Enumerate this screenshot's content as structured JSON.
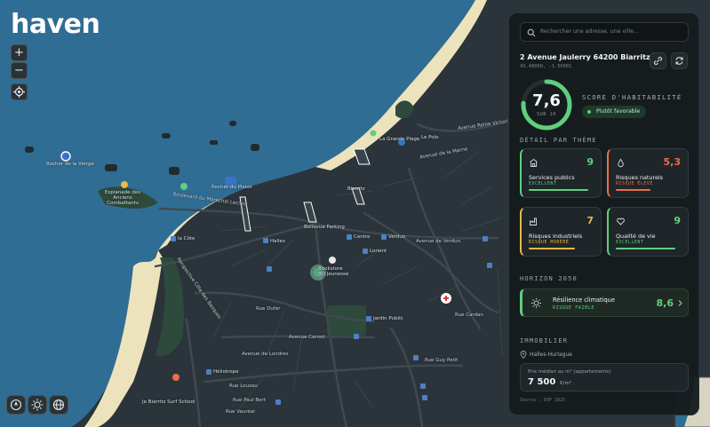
{
  "app": {
    "logo": "haven"
  },
  "map_controls": {
    "zoom_in": "+",
    "zoom_out": "−"
  },
  "map_labels": {
    "rocher_vierge": "Rocher de la Vierge",
    "esplanade": "Esplanade des Anciens Combattants",
    "rocher_plaisir": "Rocher du Plaisir",
    "grande_plage": "La Grande Plage",
    "boulevard_marechal": "Boulevard du Maréchal Leclerc",
    "avenue_reine_victoria": "Avenue Reine Victoria",
    "avenue_marne": "Avenue de la Marne",
    "le_polo": "Le Polo",
    "biarritz": "Biarritz",
    "bellevue_parking": "Bellevue Parking",
    "halles": "Halles",
    "centre": "Centre",
    "verdun": "Verdun",
    "avenue_verdun": "Avenue de Verdun",
    "lorient": "Lorient",
    "bookstore": "Bookstore BD Jeunesse",
    "la_cote": "la Côte",
    "perspective": "Perspective Côte des Basques",
    "rue_dufer": "Rue Dufer",
    "avenue_carnot": "Avenue Carnot",
    "jardin_public": "Jardin Public",
    "rue_cardan": "Rue Cardan",
    "avenue_londres": "Avenue de Londres",
    "rue_paul_bert": "Rue Paul Bert",
    "rue_louzau": "Rue Louzau",
    "rue_vaureal": "Rue Vauréal",
    "rue_guy_petit": "Rue Guy Petit",
    "surf_school": "Je Biarritz Surf School",
    "heliotrope": "Héliotrope"
  },
  "panel": {
    "search_placeholder": "Rechercher une adresse, une ville...",
    "address": "2 Avenue Jaulerry 64200 Biarritz",
    "coords": "43.48060, -1.56001",
    "score": {
      "value": "7,6",
      "max": "SUR 10",
      "value_fraction": 0.76,
      "title": "SCORE D'HABITABILITÉ",
      "verdict": "Plutôt favorable"
    },
    "themes_title": "DÉTAIL PAR THÈME",
    "themes": [
      {
        "title": "Services publics",
        "status": "EXCELLENT",
        "score": "9",
        "level": 0.9,
        "color": "#5fcf7e"
      },
      {
        "title": "Risques naturels",
        "status": "RISQUE ÉLEVÉ",
        "score": "5,3",
        "level": 0.53,
        "color": "#ea6e4b"
      },
      {
        "title": "Risques industriels",
        "status": "RISQUE MODÉRÉ",
        "score": "7",
        "level": 0.7,
        "color": "#e8b84a"
      },
      {
        "title": "Qualité de vie",
        "status": "EXCELLENT",
        "score": "9",
        "level": 0.9,
        "color": "#5fcf7e"
      }
    ],
    "horizon_title": "HORIZON 2050",
    "resilience": {
      "title": "Résilience climatique",
      "status": "RISQUE FAIBLE",
      "score": "8,6"
    },
    "immobilier_title": "IMMOBILIER",
    "location": "Halles-Hurlague",
    "price_label": "Prix médian au m² (appartements)",
    "price_value": "7 500",
    "price_unit": "€/m²",
    "source": "Source : DVF 2025"
  }
}
